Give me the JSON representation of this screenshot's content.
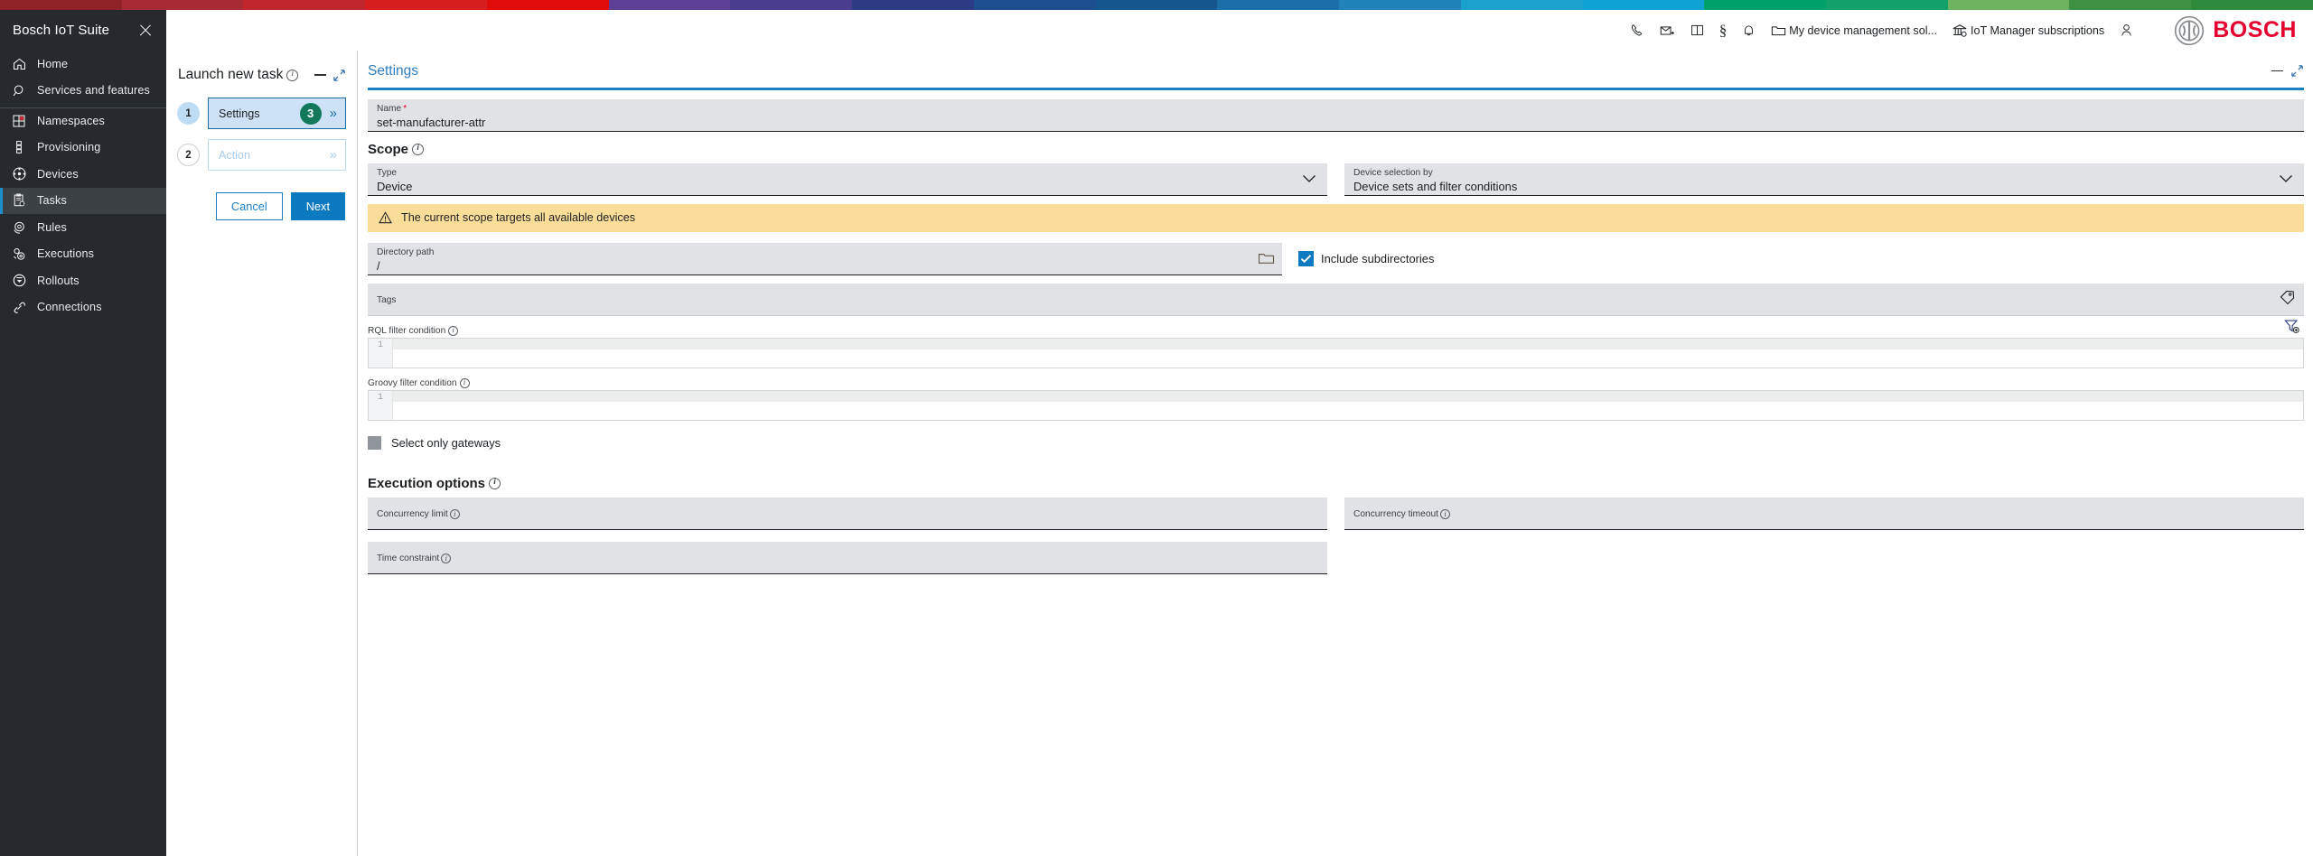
{
  "top_stripe_colors": [
    "#8e2227",
    "#a82a33",
    "#c1272d",
    "#d81f1f",
    "#e00b0b",
    "#5e3f96",
    "#4a3d8f",
    "#2c3b84",
    "#1d4f8f",
    "#15568f",
    "#1a6fa8",
    "#2183b8",
    "#19a0cc",
    "#0fa3d4",
    "#00a06b",
    "#13a06a",
    "#6db35f",
    "#3f9142",
    "#2e8b3c"
  ],
  "sidebar": {
    "title": "Bosch IoT Suite",
    "close_icon": "close-icon",
    "items": [
      {
        "label": "Home",
        "icon": "home-icon",
        "active": false,
        "separator_after": false
      },
      {
        "label": "Services and features",
        "icon": "search-icon",
        "active": false,
        "separator_after": true
      },
      {
        "label": "Namespaces",
        "icon": "grid-icon",
        "active": false,
        "separator_after": false
      },
      {
        "label": "Provisioning",
        "icon": "provisioning-icon",
        "active": false,
        "separator_after": false
      },
      {
        "label": "Devices",
        "icon": "devices-icon",
        "active": false,
        "separator_after": false
      },
      {
        "label": "Tasks",
        "icon": "tasks-icon",
        "active": true,
        "separator_after": false
      },
      {
        "label": "Rules",
        "icon": "rules-icon",
        "active": false,
        "separator_after": false
      },
      {
        "label": "Executions",
        "icon": "executions-icon",
        "active": false,
        "separator_after": false
      },
      {
        "label": "Rollouts",
        "icon": "rollouts-icon",
        "active": false,
        "separator_after": false
      },
      {
        "label": "Connections",
        "icon": "connections-icon",
        "active": false,
        "separator_after": false
      }
    ]
  },
  "header": {
    "icons": [
      {
        "name": "phone-icon",
        "label": ""
      },
      {
        "name": "mail-icon",
        "label": ""
      },
      {
        "name": "book-icon",
        "label": ""
      },
      {
        "name": "legal-section-icon",
        "label": ""
      },
      {
        "name": "bell-icon",
        "label": ""
      }
    ],
    "solution_label": "My device management sol...",
    "subscriptions_label": "IoT Manager subscriptions",
    "account_icon": "user-icon",
    "brand": "BOSCH",
    "brand_color": "#e4032e"
  },
  "wizard": {
    "title": "Launch new task",
    "minimize_icon": "minimize-icon",
    "expand_icon": "expand-icon",
    "steps": [
      {
        "number": "1",
        "label": "Settings",
        "badge": "3",
        "active": true
      },
      {
        "number": "2",
        "label": "Action",
        "badge": "",
        "active": false
      }
    ],
    "cancel_label": "Cancel",
    "next_label": "Next",
    "badge_color": "#13795b",
    "next_color": "#0b7ac0"
  },
  "settings": {
    "panel_title": "Settings",
    "minimize_icon": "minimize-icon",
    "expand_icon": "expand-icon",
    "name_field": {
      "label": "Name",
      "required_marker": "*",
      "value": "set-manufacturer-attr"
    },
    "scope": {
      "heading": "Scope",
      "type_field": {
        "label": "Type",
        "value": "Device"
      },
      "selection_field": {
        "label": "Device selection by",
        "value": "Device sets and filter conditions"
      },
      "warning": {
        "icon": "warning-icon",
        "text": "The current scope targets all available devices",
        "color": "#fbdd9a"
      },
      "directory_field": {
        "label": "Directory path",
        "value": "/",
        "browse_icon": "folder-icon"
      },
      "include_subdirectories": {
        "label": "Include subdirectories",
        "checked": true
      },
      "tags_field": {
        "label": "Tags",
        "value": "",
        "icon": "tag-icon"
      },
      "rql_filter": {
        "label": "RQL filter condition",
        "line_number": "1",
        "value": "",
        "icon": "filter-add-icon"
      },
      "groovy_filter": {
        "label": "Groovy filter condition",
        "line_number": "1",
        "value": ""
      },
      "select_only_gateways": {
        "label": "Select only gateways",
        "checked": false,
        "disabled": true
      }
    },
    "execution_options": {
      "heading": "Execution options",
      "concurrency_limit": {
        "label": "Concurrency limit",
        "value": ""
      },
      "concurrency_timeout": {
        "label": "Concurrency timeout",
        "value": ""
      },
      "time_constraint": {
        "label": "Time constraint",
        "value": ""
      }
    }
  }
}
